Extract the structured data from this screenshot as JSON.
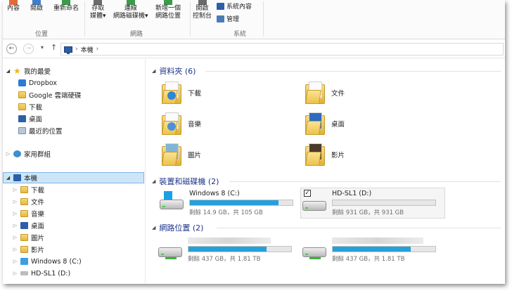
{
  "ribbon": {
    "open_group": {
      "buttons": [
        "內容",
        "開啟",
        "重新命名"
      ],
      "label": "位置"
    },
    "network_group": {
      "buttons": [
        {
          "line1": "存取",
          "line2": "媒體▾"
        },
        {
          "line1": "連線",
          "line2": "網路磁碟機▾"
        },
        {
          "line1": "新增一個",
          "line2": "網路位置"
        }
      ],
      "label": "網路"
    },
    "system_group": {
      "open_cp": {
        "line1": "開啟",
        "line2": "控制台"
      },
      "items": [
        "系統內容",
        "管理"
      ],
      "label": "系統"
    }
  },
  "nav": {
    "back": "←",
    "forward": "→",
    "recent": "▾",
    "up": "↑",
    "breadcrumb": [
      "本機"
    ],
    "sep": "›"
  },
  "sidebar": {
    "favorites": {
      "label": "我的最愛",
      "items": [
        "Dropbox",
        "Google 雲端硬碟",
        "下載",
        "桌面",
        "最近的位置"
      ]
    },
    "homegroup": "家用群組",
    "this_pc": {
      "label": "本機",
      "items": [
        "下載",
        "文件",
        "音樂",
        "桌面",
        "圖片",
        "影片",
        "Windows 8 (C:)",
        "HD-SL1 (D:)"
      ]
    }
  },
  "content": {
    "folders_section": "資料夾 (6)",
    "folders": [
      "下載",
      "文件",
      "音樂",
      "桌面",
      "圖片",
      "影片"
    ],
    "devices_section": "裝置和磁碟機 (2)",
    "drives": [
      {
        "name": "Windows 8 (C:)",
        "free": "剩餘 14.9 GB，共 105 GB",
        "used_fraction": 0.86
      },
      {
        "name": "HD-SL1 (D:)",
        "free": "剩餘 931 GB，共 931 GB",
        "used_fraction": 0.0
      }
    ],
    "network_section": "網路位置 (2)",
    "network": [
      {
        "free": "剩餘 437 GB，共 1.81 TB",
        "used_fraction": 0.76
      },
      {
        "free": "剩餘 437 GB，共 1.81 TB",
        "used_fraction": 0.76
      }
    ]
  },
  "colors": {
    "accent_blue": "#26a0da",
    "section_head": "#1e3287",
    "selection_bg": "#cde6f7"
  }
}
